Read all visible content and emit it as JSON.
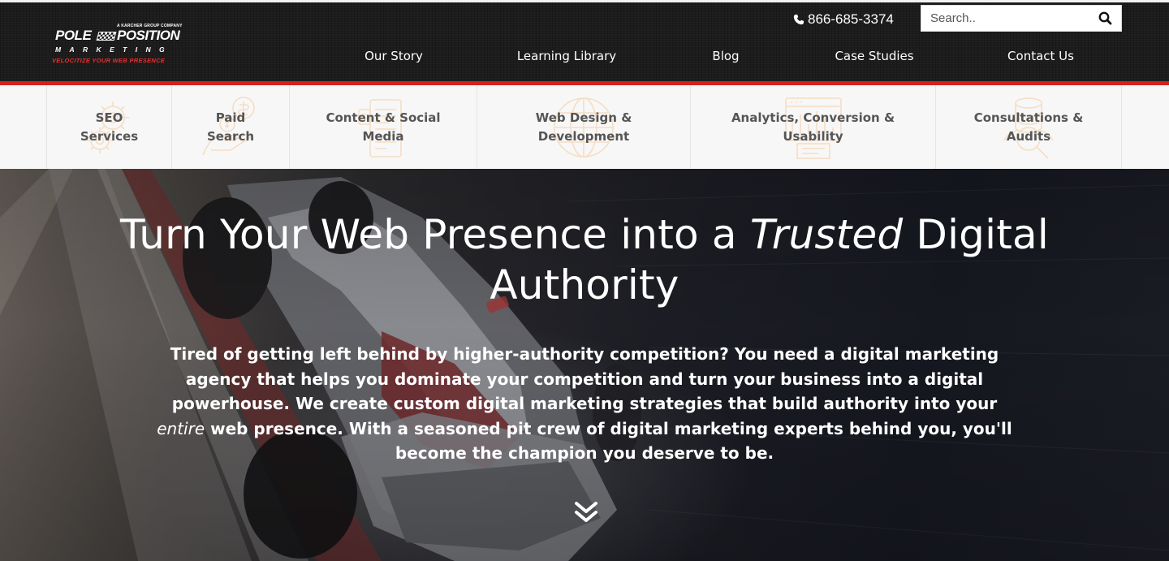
{
  "brand": {
    "company_line": "A KARCHER GROUP COMPANY",
    "name_part1": "POLE",
    "name_part2": "POSITION",
    "name_line2": "MARKETING",
    "tagline": "VELOCITIZE YOUR WEB PRESENCE",
    "accent_color": "#d32121"
  },
  "header": {
    "phone": "866-685-3374",
    "phone_icon": "phone-icon",
    "search": {
      "placeholder": "Search..",
      "value": "",
      "icon": "search-icon"
    },
    "nav": [
      {
        "label": "Our Story"
      },
      {
        "label": "Learning Library"
      },
      {
        "label": "Blog"
      },
      {
        "label": "Case Studies"
      },
      {
        "label": "Contact Us"
      }
    ]
  },
  "services": [
    {
      "label": "SEO\nServices",
      "icon": "gears-icon"
    },
    {
      "label": "Paid\nSearch",
      "icon": "money-hand-icon"
    },
    {
      "label": "Content & Social\nMedia",
      "icon": "document-icon"
    },
    {
      "label": "Web Design &\nDevelopment",
      "icon": "globe-icon"
    },
    {
      "label": "Analytics, Conversion &\nUsability",
      "icon": "browser-chart-icon"
    },
    {
      "label": "Consultations &\nAudits",
      "icon": "magnifier-database-icon"
    }
  ],
  "hero": {
    "title_pre": "Turn Your Web Presence into a ",
    "title_em": "Trusted",
    "title_post": " Digital Authority",
    "text_pre": "Tired of getting left behind by higher-authority competition? You need a digital marketing agency that helps you dominate your competition and turn your business into a digital powerhouse. We create custom digital marketing strategies that build authority into your ",
    "text_em": "entire",
    "text_post": " web presence. With a seasoned pit crew of digital marketing experts behind you, you'll become the champion you deserve to be.",
    "scroll_icon": "double-chevron-down-icon"
  }
}
